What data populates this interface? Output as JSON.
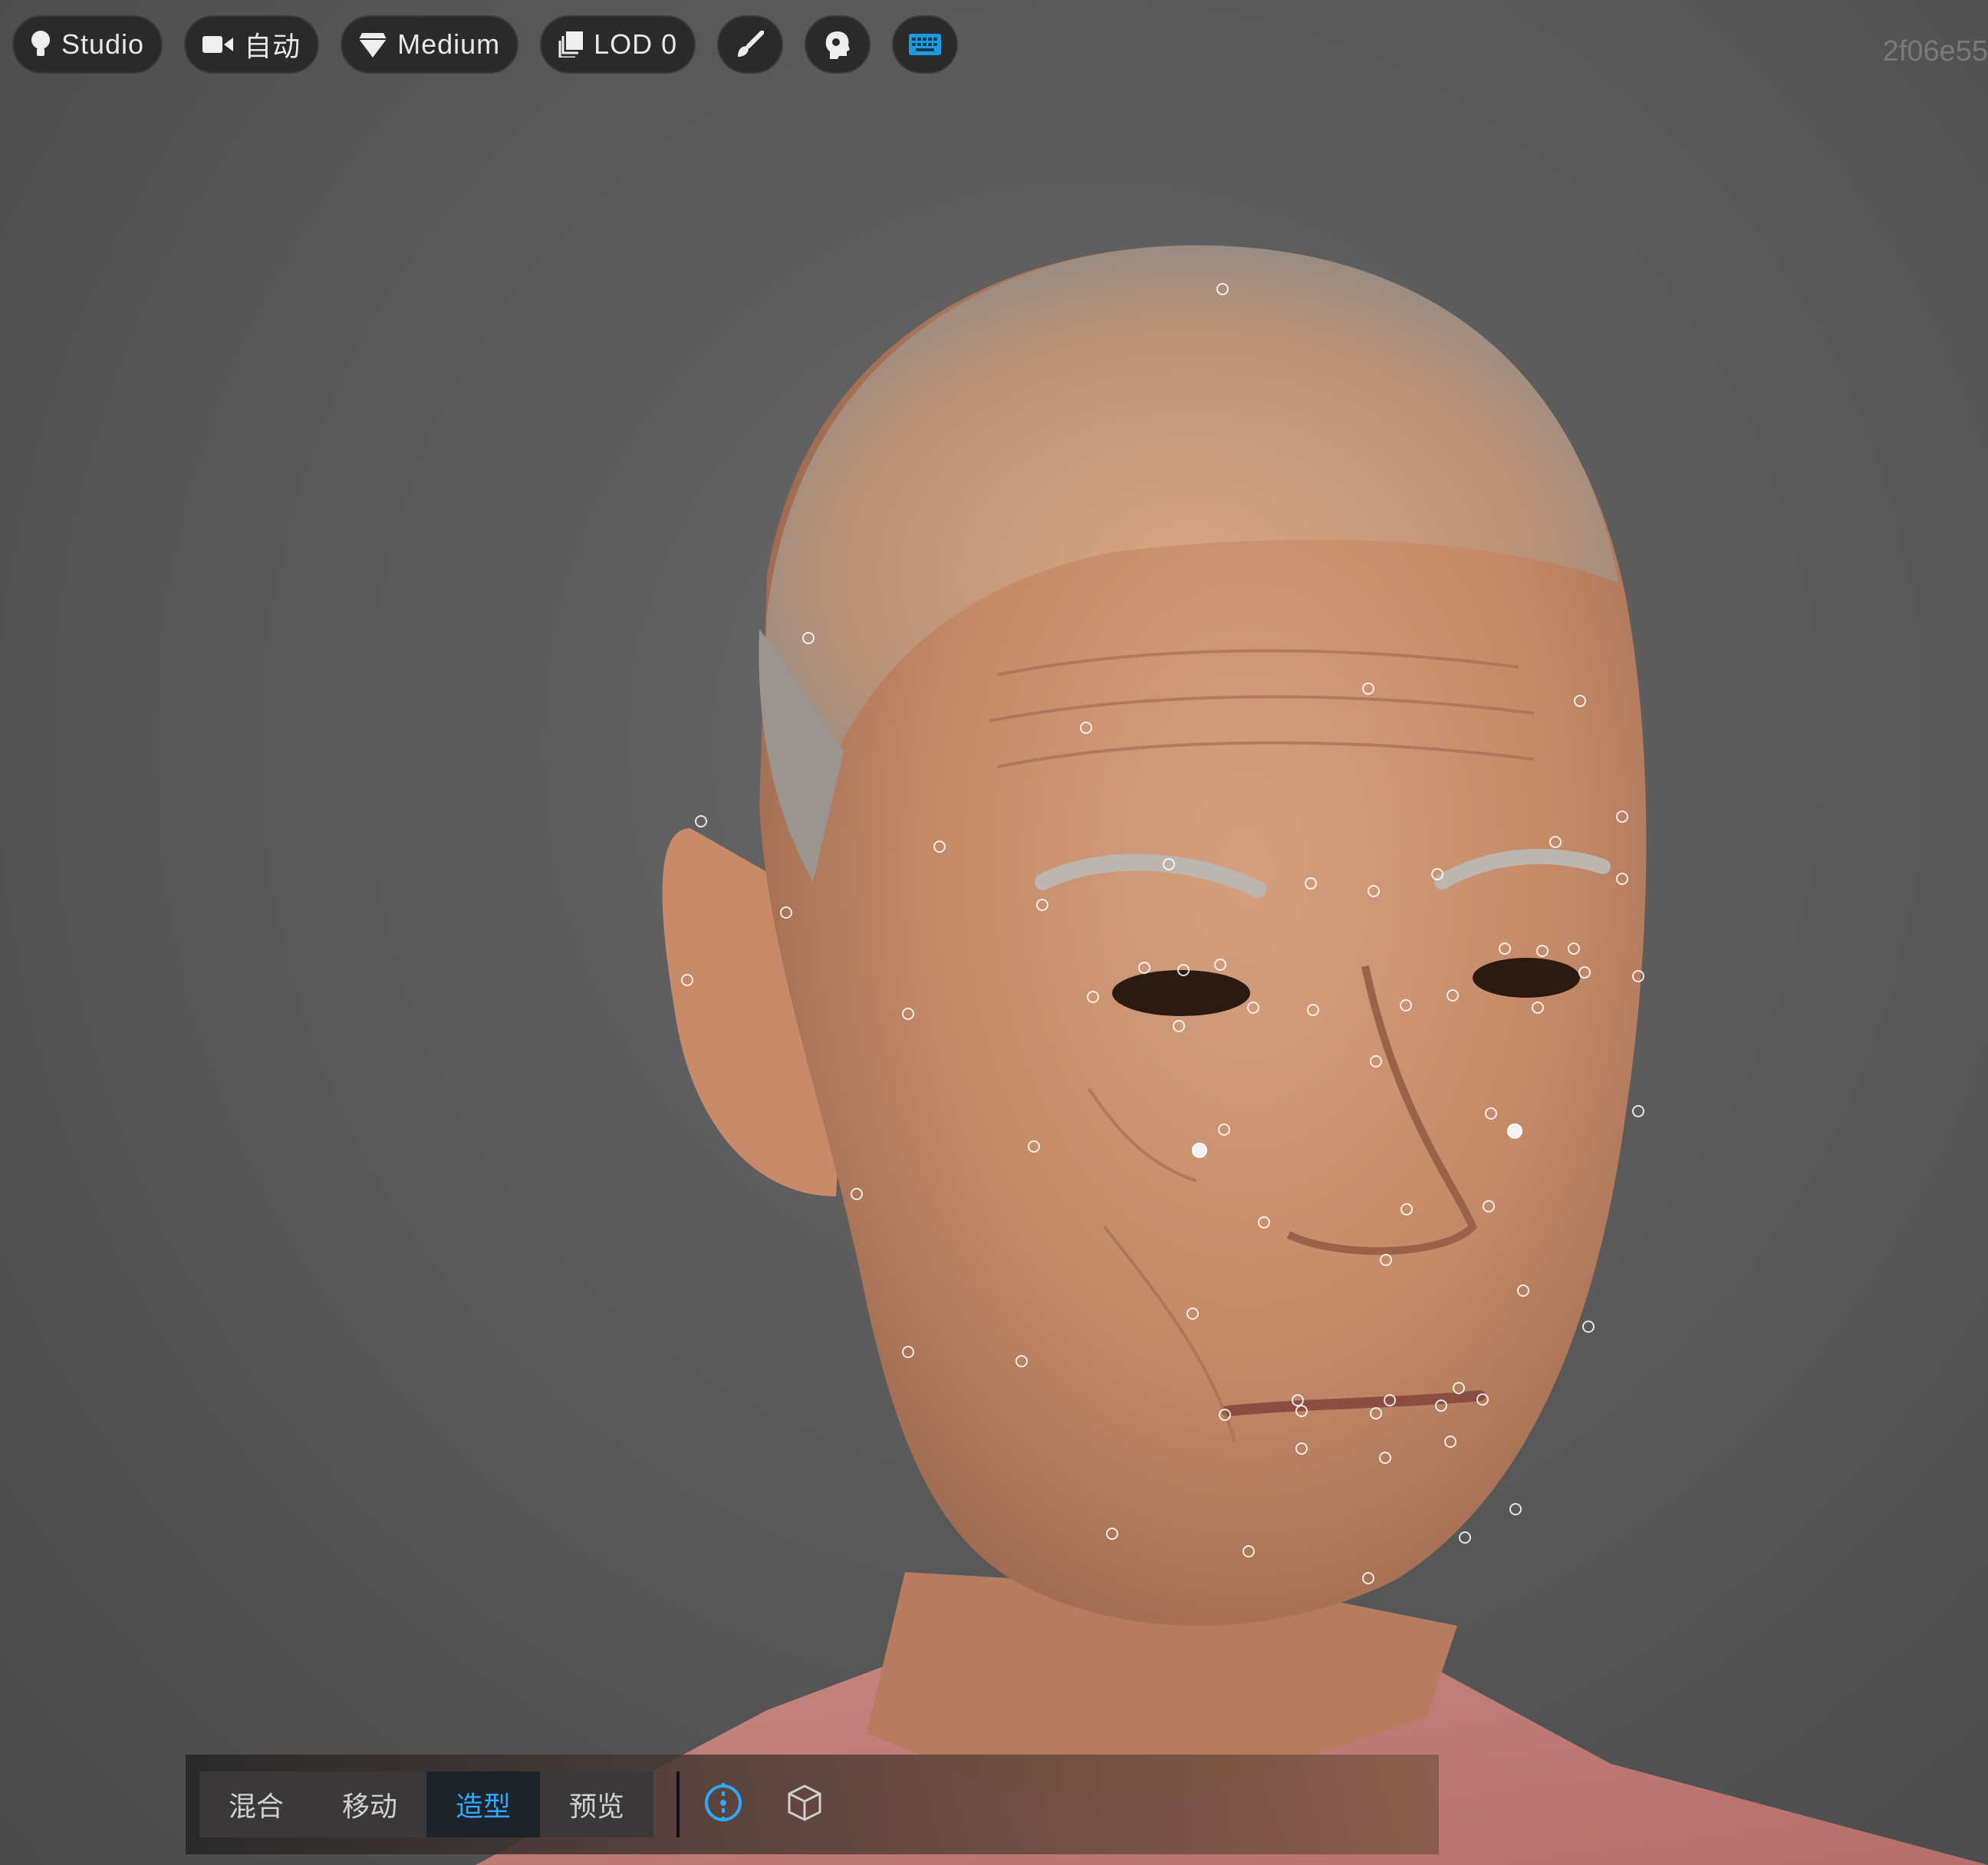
{
  "toolbar": {
    "lighting_label": "Studio",
    "camera_label": "自动",
    "quality_label": "Medium",
    "lod_label": "LOD 0",
    "icons": [
      "lightbulb-icon",
      "camera-icon",
      "gem-icon",
      "layers-icon",
      "brush-icon",
      "head-icon",
      "keyboard-icon"
    ],
    "accent_color": "#1e9be0"
  },
  "asset_id": "2f06e55",
  "mode_bar": {
    "modes": [
      "混合",
      "移动",
      "造型",
      "预览"
    ],
    "active_mode": "造型",
    "tools": [
      "pivot-icon",
      "cube-icon"
    ],
    "active_color": "#2ea8ff"
  }
}
